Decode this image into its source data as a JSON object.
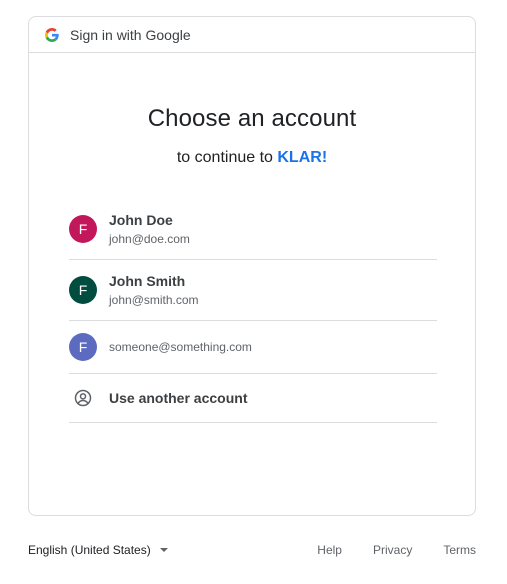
{
  "header": {
    "text": "Sign in with Google",
    "logo_icon": "google-g-icon"
  },
  "main": {
    "title": "Choose an account",
    "subtitle_prefix": "to continue to ",
    "app_name": "KLAR!",
    "app_name_color": "#1a73e8"
  },
  "accounts": [
    {
      "initial": "F",
      "name": "John Doe",
      "email": "john@doe.com",
      "avatar_color": "#c2185b"
    },
    {
      "initial": "F",
      "name": "John Smith",
      "email": "john@smith.com",
      "avatar_color": "#004d40"
    },
    {
      "initial": "F",
      "name": "",
      "email": "someone@something.com",
      "avatar_color": "#5c6bc0"
    }
  ],
  "use_another": {
    "label": "Use another account",
    "icon": "account-circle-icon"
  },
  "footer": {
    "language": "English (United States)",
    "links": [
      "Help",
      "Privacy",
      "Terms"
    ]
  }
}
